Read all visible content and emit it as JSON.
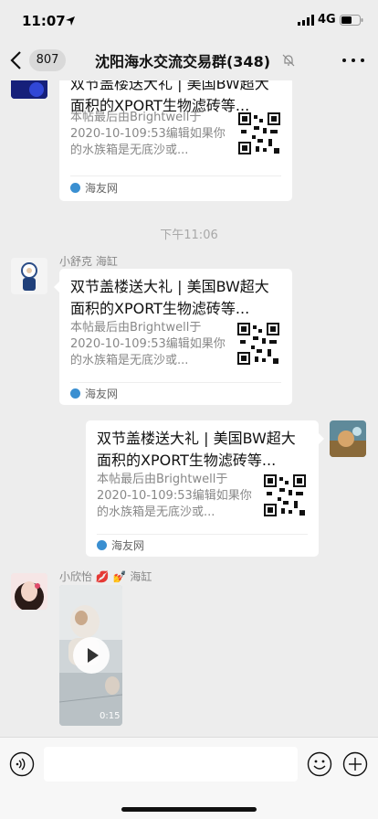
{
  "status_bar": {
    "time": "11:07",
    "network": "4G"
  },
  "header": {
    "unread_count": "807",
    "title": "沈阳海水交流交易群(348)"
  },
  "time_divider": "下午11:06",
  "link_card": {
    "title": "双节盖楼送大礼 | 美国BW超大面积的XPORT生物滤砖等...",
    "description": "本帖最后由Brightwell于2020-10-109:53编辑如果你的水族箱是无底沙或...",
    "source": "海友网"
  },
  "messages": [
    {
      "sender": "小舒克 海缸"
    },
    {
      "sender": "me"
    },
    {
      "sender": "小欣怡 💋 💅 海缸",
      "video_duration": "0:15"
    }
  ],
  "input": {
    "placeholder": ""
  },
  "colors": {
    "background": "#ededed",
    "card": "#ffffff",
    "muted_text": "#888888",
    "source_icon": "#3a8fd1"
  }
}
